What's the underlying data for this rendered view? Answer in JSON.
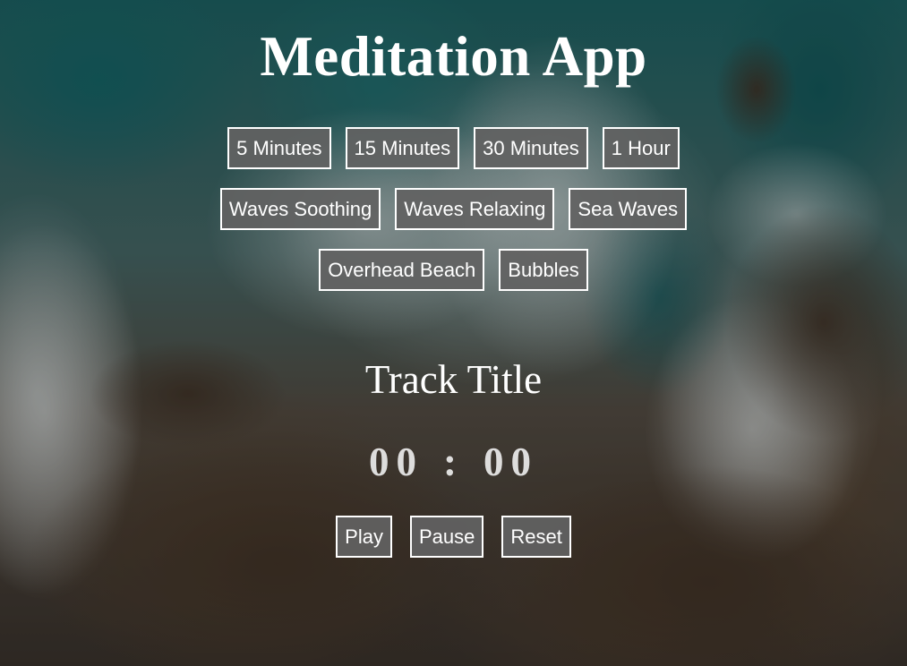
{
  "app": {
    "title": "Meditation App"
  },
  "durations": [
    {
      "label": "5 Minutes"
    },
    {
      "label": "15 Minutes"
    },
    {
      "label": "30 Minutes"
    },
    {
      "label": "1 Hour"
    }
  ],
  "sounds": [
    {
      "label": "Waves Soothing"
    },
    {
      "label": "Waves Relaxing"
    },
    {
      "label": "Sea Waves"
    },
    {
      "label": "Overhead Beach"
    },
    {
      "label": "Bubbles"
    }
  ],
  "player": {
    "track_title": "Track Title",
    "timer": {
      "minutes": "00",
      "separator": ":",
      "seconds": "00"
    },
    "controls": {
      "play": "Play",
      "pause": "Pause",
      "reset": "Reset"
    }
  },
  "colors": {
    "button_bg": "#626262",
    "button_border": "#ffffff",
    "text": "#ffffff"
  }
}
